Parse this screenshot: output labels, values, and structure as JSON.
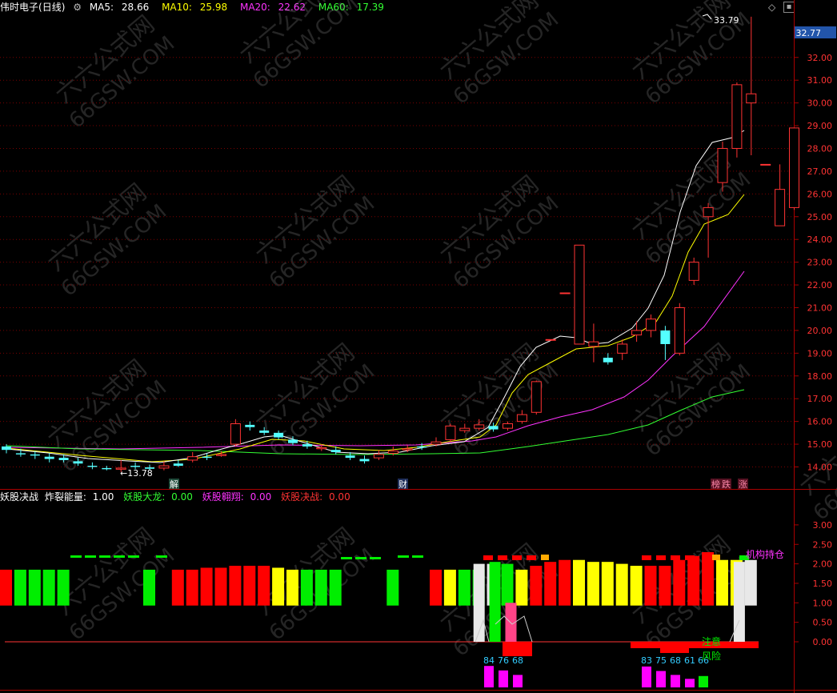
{
  "stock": {
    "name": "伟时电子",
    "period": "(日线)",
    "ma": [
      {
        "label": "MA5:",
        "value": "28.66",
        "color": "#ffffff"
      },
      {
        "label": "MA10:",
        "value": "25.98",
        "color": "#ffff00"
      },
      {
        "label": "MA20:",
        "value": "22.62",
        "color": "#ff33ff"
      },
      {
        "label": "MA60:",
        "value": "17.39",
        "color": "#33ff33"
      }
    ],
    "current_price": "32.77",
    "high_label": "33.79",
    "low_label": "13.78"
  },
  "indicator": {
    "title": "妖股决战",
    "fields": [
      {
        "label": "炸裂能量:",
        "value": "1.00",
        "color": "#ffffff"
      },
      {
        "label": "妖股大龙:",
        "value": "0.00",
        "color": "#33ff33"
      },
      {
        "label": "妖股翱翔:",
        "value": "0.00",
        "color": "#ff33ff"
      },
      {
        "label": "妖股决战:",
        "value": "0.00",
        "color": "#ff3333"
      }
    ],
    "annotations": {
      "institution": "机构持仓",
      "notice": "注意",
      "risk": "风险"
    }
  },
  "markers": {
    "jie": "解",
    "cai": "财",
    "bang": "榜",
    "die": "跌",
    "zhang": "涨"
  },
  "bottom_numbers": [
    "84",
    "76",
    "68",
    "83",
    "75",
    "68",
    "61",
    "66"
  ],
  "price_axis": [
    "32.00",
    "31.00",
    "30.00",
    "29.00",
    "28.00",
    "27.00",
    "26.00",
    "25.00",
    "24.00",
    "23.00",
    "22.00",
    "21.00",
    "20.00",
    "19.00",
    "18.00",
    "17.00",
    "16.00",
    "15.00",
    "14.00"
  ],
  "ind_axis": [
    "3.00",
    "2.50",
    "2.00",
    "1.50",
    "1.00",
    "0.50",
    "0.00"
  ],
  "watermark": {
    "cn": "六六公式网",
    "en": "66GSW.COM"
  },
  "colors": {
    "up": "#ff3333",
    "down": "#54ffff",
    "grid": "#7a0000",
    "axis": "#aa0000"
  },
  "chart_data": {
    "type": "candlestick",
    "candles": [
      [
        14.9,
        14.75,
        15.0,
        14.6
      ],
      [
        14.6,
        14.55,
        14.8,
        14.45
      ],
      [
        14.55,
        14.5,
        14.7,
        14.35
      ],
      [
        14.45,
        14.35,
        14.6,
        14.2
      ],
      [
        14.4,
        14.3,
        14.55,
        14.2
      ],
      [
        14.25,
        14.15,
        14.4,
        14.05
      ],
      [
        14.05,
        14.0,
        14.2,
        13.9
      ],
      [
        13.95,
        13.9,
        14.05,
        13.85
      ],
      [
        13.9,
        13.95,
        14.3,
        13.78
      ],
      [
        14.05,
        14.0,
        14.2,
        13.9
      ],
      [
        13.98,
        13.92,
        14.1,
        13.85
      ],
      [
        13.95,
        14.05,
        14.25,
        13.85
      ],
      [
        14.15,
        14.05,
        14.3,
        14.0
      ],
      [
        14.3,
        14.45,
        14.65,
        14.2
      ],
      [
        14.45,
        14.4,
        14.6,
        14.3
      ],
      [
        14.5,
        14.55,
        14.7,
        14.45
      ],
      [
        15.0,
        15.9,
        16.1,
        14.9
      ],
      [
        15.85,
        15.75,
        16.0,
        15.6
      ],
      [
        15.6,
        15.5,
        15.75,
        15.4
      ],
      [
        15.5,
        15.3,
        15.6,
        15.2
      ],
      [
        15.2,
        15.05,
        15.35,
        14.95
      ],
      [
        15.0,
        14.9,
        15.15,
        14.8
      ],
      [
        14.8,
        14.85,
        15.0,
        14.7
      ],
      [
        14.75,
        14.65,
        14.9,
        14.55
      ],
      [
        14.5,
        14.4,
        14.65,
        14.3
      ],
      [
        14.35,
        14.25,
        14.5,
        14.15
      ],
      [
        14.4,
        14.55,
        14.75,
        14.3
      ],
      [
        14.6,
        14.7,
        14.9,
        14.5
      ],
      [
        14.75,
        14.8,
        14.95,
        14.65
      ],
      [
        14.9,
        14.85,
        15.05,
        14.75
      ],
      [
        15.0,
        15.1,
        15.3,
        14.9
      ],
      [
        15.2,
        15.8,
        15.9,
        15.1
      ],
      [
        15.6,
        15.7,
        15.9,
        15.5
      ],
      [
        15.7,
        15.85,
        16.1,
        15.6
      ],
      [
        15.8,
        15.65,
        15.95,
        15.55
      ],
      [
        15.7,
        15.9,
        16.0,
        15.6
      ],
      [
        16.0,
        16.3,
        16.5,
        15.9
      ],
      [
        16.4,
        17.75,
        17.8,
        16.3
      ],
      [
        19.6,
        19.6,
        19.6,
        19.6
      ],
      [
        21.65,
        21.65,
        21.65,
        21.65
      ],
      [
        19.4,
        23.75,
        23.75,
        19.4
      ],
      [
        19.3,
        19.5,
        20.3,
        18.6
      ],
      [
        18.8,
        18.6,
        19.0,
        18.5
      ],
      [
        19.0,
        19.4,
        19.6,
        18.7
      ],
      [
        19.8,
        20.0,
        20.4,
        19.5
      ],
      [
        20.0,
        20.5,
        20.7,
        19.7
      ],
      [
        20.0,
        19.4,
        20.2,
        18.7
      ],
      [
        19.0,
        21.0,
        21.2,
        18.9
      ],
      [
        22.2,
        23.0,
        23.2,
        22.0
      ],
      [
        25.0,
        25.4,
        25.6,
        23.2
      ],
      [
        26.5,
        28.0,
        28.3,
        26.1
      ],
      [
        28.0,
        30.8,
        30.9,
        27.6
      ],
      [
        30.0,
        30.4,
        33.79,
        27.7
      ],
      [
        27.3,
        27.3,
        27.3,
        27.3
      ],
      [
        24.6,
        26.2,
        27.3,
        24.6
      ],
      [
        25.4,
        28.9,
        28.9,
        25.3
      ]
    ]
  }
}
